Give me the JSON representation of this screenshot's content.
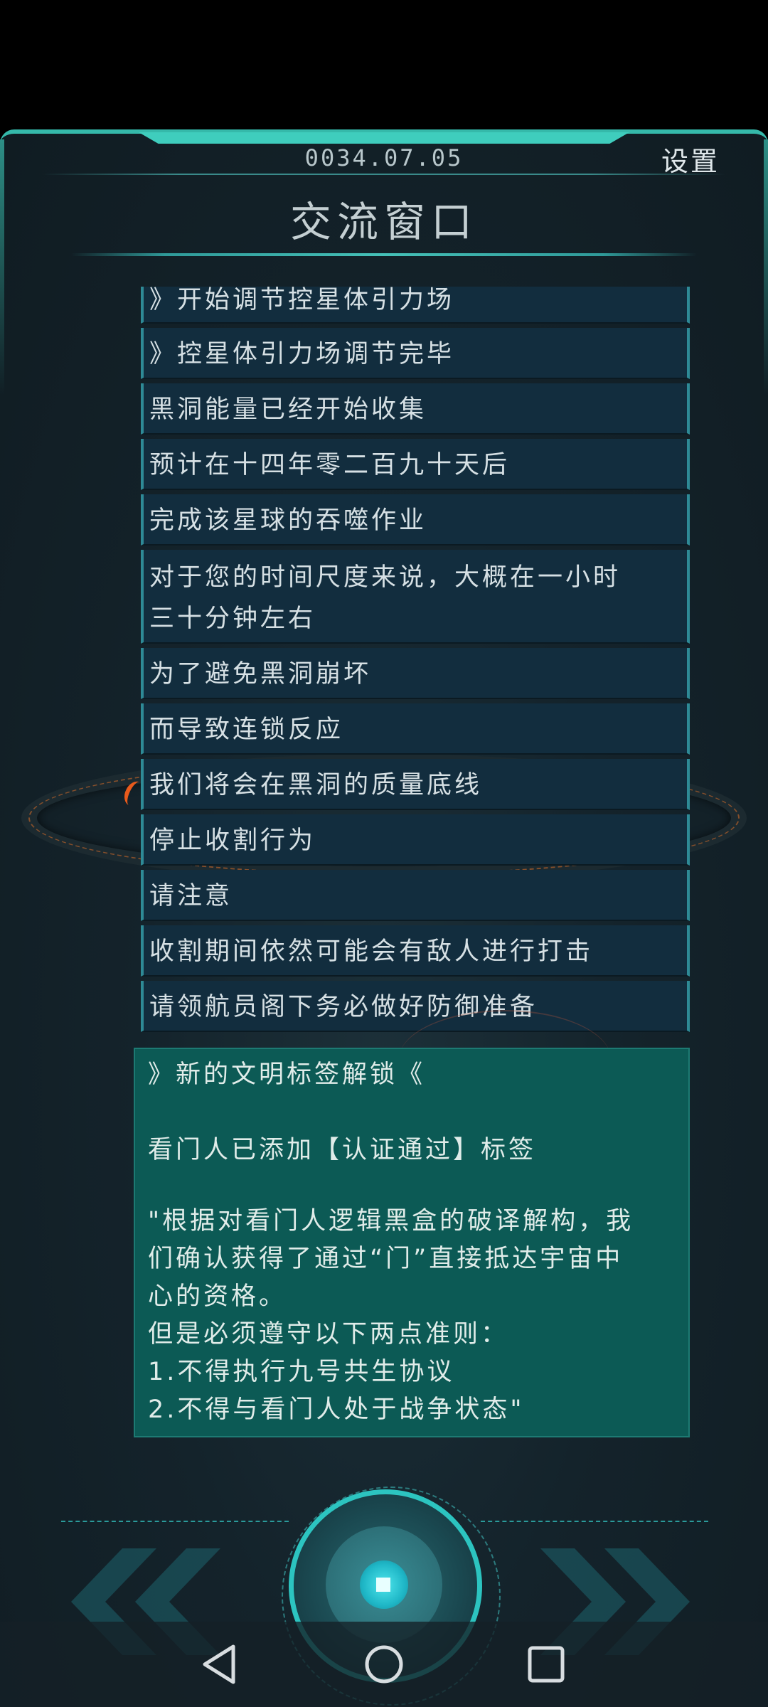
{
  "header": {
    "date": "0034.07.05",
    "settings_label": "设置",
    "title": "交流窗口"
  },
  "messages": [
    "》开始调节控星体引力场",
    "》控星体引力场调节完毕",
    "黑洞能量已经开始收集",
    "预计在十四年零二百九十天后",
    "完成该星球的吞噬作业",
    "对于您的时间尺度来说，大概在一小时",
    "三十分钟左右",
    "为了避免黑洞崩坏",
    "而导致连锁反应",
    "我们将会在黑洞的质量底线",
    "停止收割行为",
    "请注意",
    "收割期间依然可能会有敌人进行打击",
    "请领航员阁下务必做好防御准备"
  ],
  "unlock": {
    "heading": "》新的文明标签解锁《",
    "tag_line": "看门人已添加【认证通过】标签",
    "quote_lines": [
      "\"根据对看门人逻辑黑盒的破译解构，我",
      "们确认获得了通过“门”直接抵达宇宙中",
      "心的资格。",
      "但是必须遵守以下两点准则：",
      "1.不得执行九号共生协议",
      "2.不得与看门人处于战争状态\""
    ]
  },
  "controls": {
    "prev_icon": "double-chevron-left-icon",
    "next_icon": "double-chevron-right-icon",
    "center_icon": "stop-square-icon",
    "accent": "#2cc4c0"
  },
  "navbar": {
    "back_icon": "triangle-back-icon",
    "home_icon": "circle-home-icon",
    "recent_icon": "square-recent-icon"
  }
}
